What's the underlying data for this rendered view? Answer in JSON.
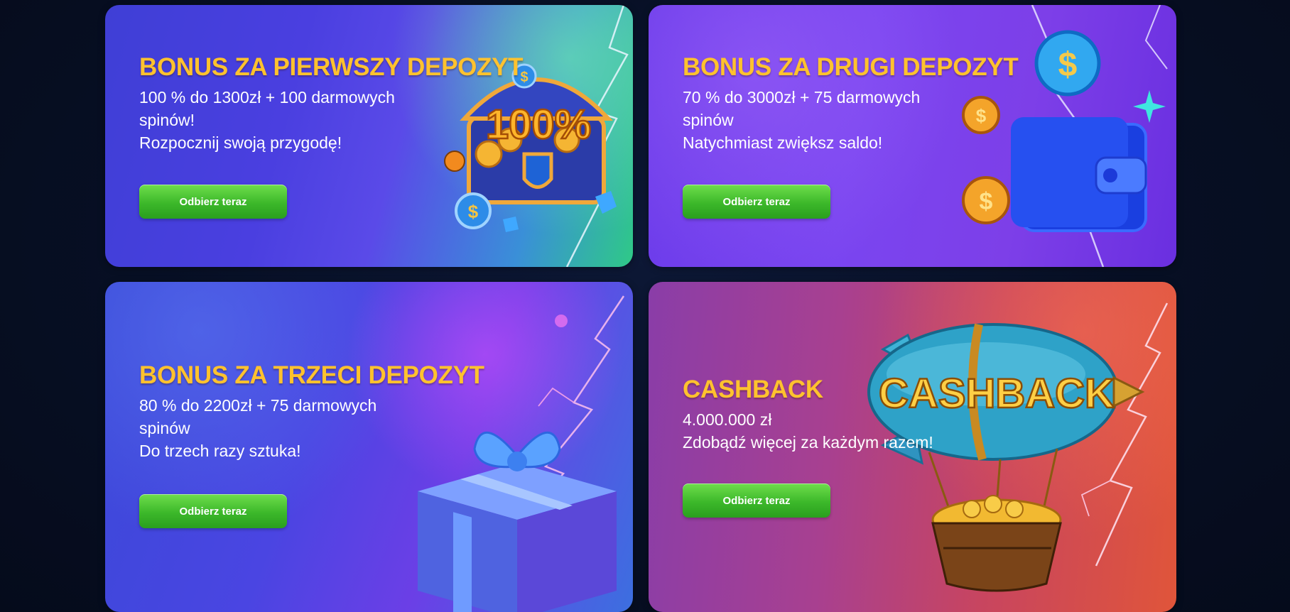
{
  "cards": [
    {
      "title": "BONUS ZA PIERWSZY DEPOZYT",
      "lines": [
        "100 % do 1300zł + 100 darmowych",
        "spinów!",
        "Rozpocznij swoją przygodę!"
      ],
      "button": "Odbierz teraz",
      "art_text": "100%",
      "icon": "treasure-chest"
    },
    {
      "title": "BONUS ZA DRUGI DEPOZYT",
      "lines": [
        "70 % do 3000zł + 75 darmowych",
        "spinów",
        "Natychmiast zwiększ saldo!"
      ],
      "button": "Odbierz teraz",
      "icon": "wallet"
    },
    {
      "title": "BONUS ZA TRZECI DEPOZYT",
      "lines": [
        "80 % do 2200zł + 75 darmowych",
        "spinów",
        "Do trzech razy sztuka!"
      ],
      "button": "Odbierz teraz",
      "icon": "gift-box"
    },
    {
      "title": "CASHBACK",
      "lines": [
        "4.000.000 zł",
        "Zdobądź więcej za każdym razem!"
      ],
      "button": "Odbierz teraz",
      "art_text": "CASHBACK",
      "icon": "airship"
    }
  ],
  "colors": {
    "page_background": "#070f24",
    "title": "#ffc22e",
    "text": "#ffffff",
    "button": "#3cb82a"
  }
}
